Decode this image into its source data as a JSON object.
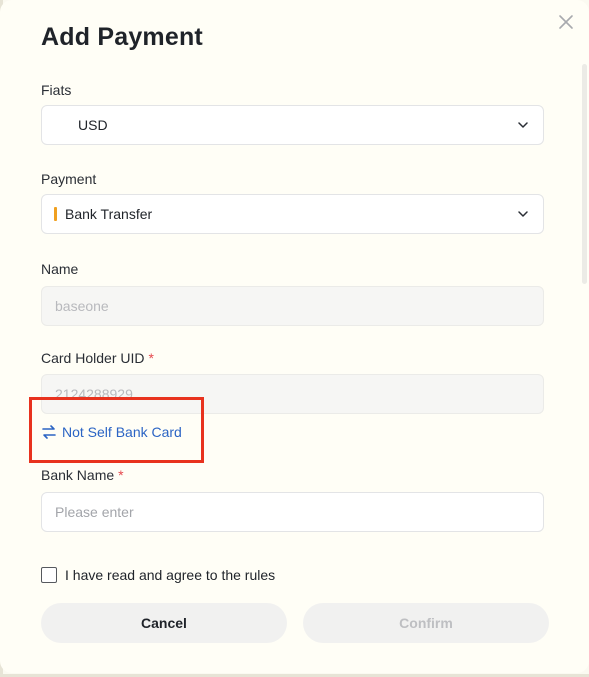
{
  "modal": {
    "title": "Add Payment",
    "close_icon": "close-icon"
  },
  "fiats": {
    "label": "Fiats",
    "value": "USD"
  },
  "payment": {
    "label": "Payment",
    "value": "Bank Transfer",
    "accent_color": "#f0a020"
  },
  "name": {
    "label": "Name",
    "placeholder": "baseone"
  },
  "card_holder": {
    "label": "Card Holder UID",
    "required_mark": "*",
    "value": "2124288929"
  },
  "switch_card": {
    "label": "Not Self Bank Card",
    "icon": "swap-icon",
    "color": "#2b64c4"
  },
  "bank_name": {
    "label": "Bank Name",
    "required_mark": "*",
    "placeholder": "Please enter"
  },
  "agreement": {
    "label": "I have read and agree to the rules",
    "checked": false
  },
  "actions": {
    "cancel_label": "Cancel",
    "confirm_label": "Confirm"
  }
}
